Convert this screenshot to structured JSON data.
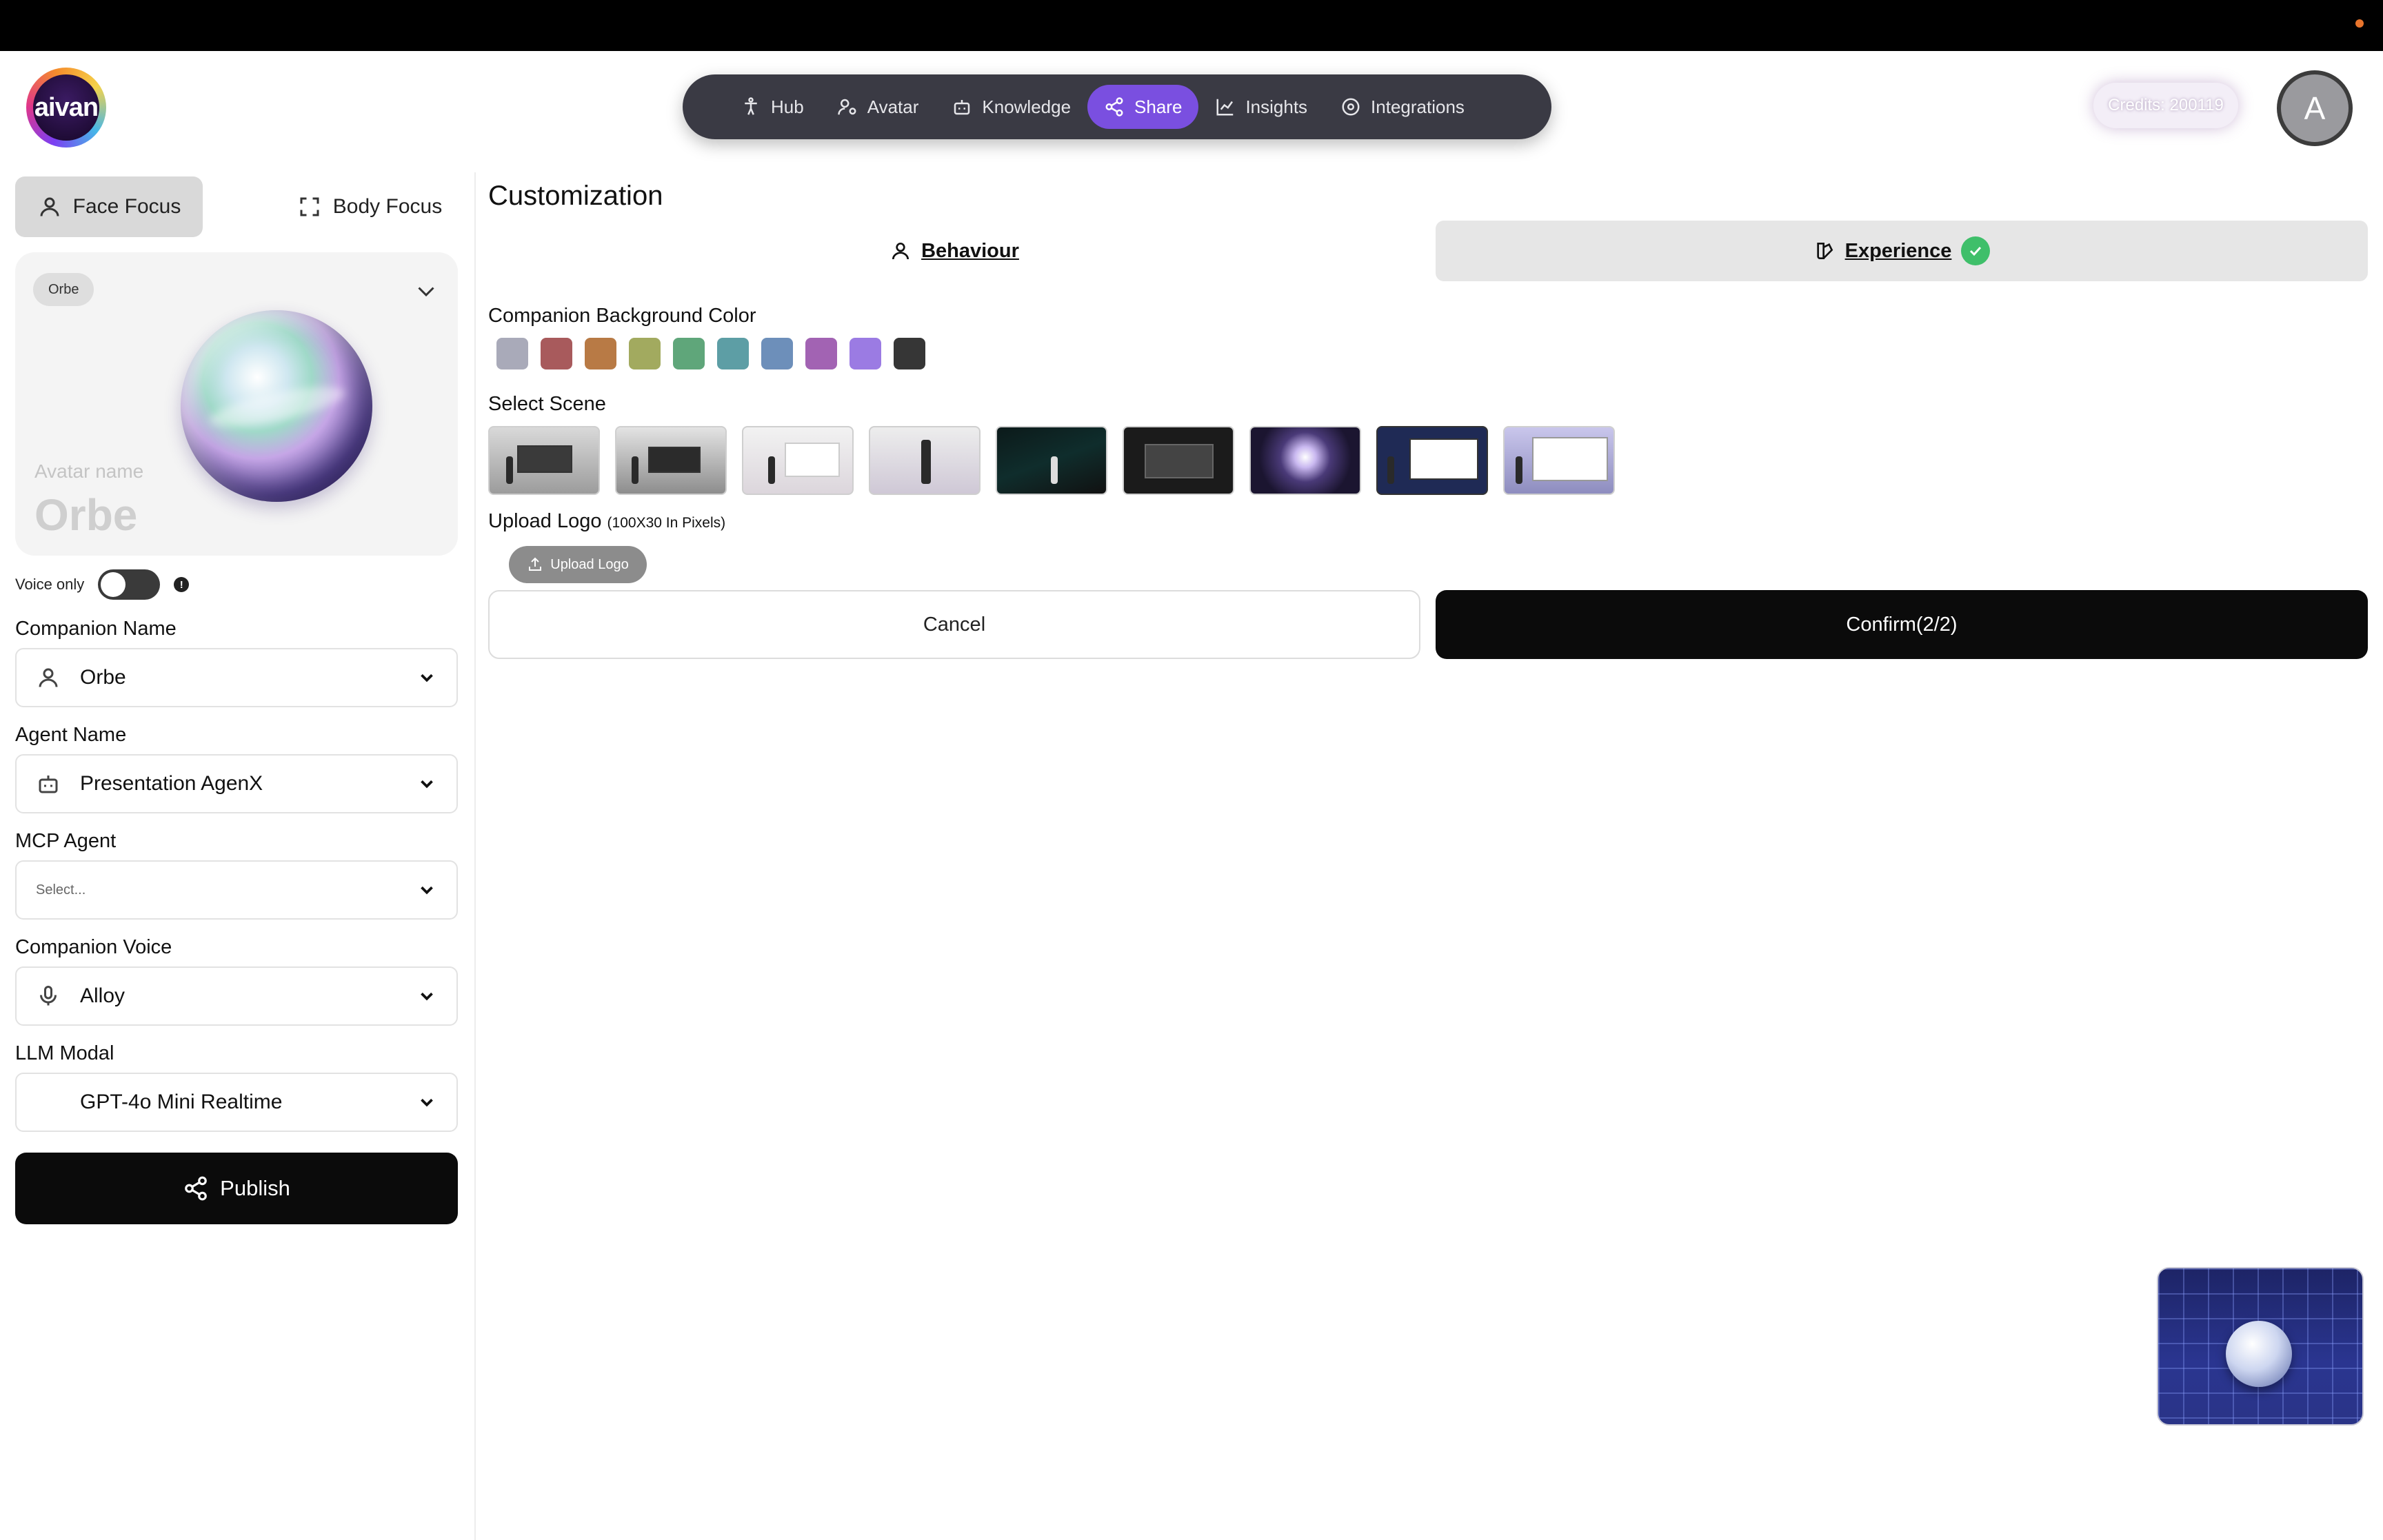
{
  "header": {
    "logo_text": "aivan",
    "nav": [
      {
        "label": "Hub",
        "icon": "accessibility-icon"
      },
      {
        "label": "Avatar",
        "icon": "user-cog-icon"
      },
      {
        "label": "Knowledge",
        "icon": "robot-icon"
      },
      {
        "label": "Share",
        "icon": "share-icon",
        "active": true
      },
      {
        "label": "Insights",
        "icon": "chart-line-icon"
      },
      {
        "label": "Integrations",
        "icon": "integrations-icon"
      }
    ],
    "credits": "Credits: 200119",
    "avatar_initial": "A"
  },
  "left": {
    "focus_tabs": {
      "face": "Face Focus",
      "body": "Body Focus"
    },
    "avatar_card": {
      "chip": "Orbe",
      "label": "Avatar name",
      "name": "Orbe"
    },
    "voice_only": "Voice only",
    "fields": {
      "companion_name": {
        "label": "Companion Name",
        "value": "Orbe"
      },
      "agent_name": {
        "label": "Agent Name",
        "value": "Presentation AgenX"
      },
      "mcp_agent": {
        "label": "MCP Agent",
        "placeholder": "Select..."
      },
      "companion_voice": {
        "label": "Companion Voice",
        "value": "Alloy"
      },
      "llm_modal": {
        "label": "LLM Modal",
        "value": "GPT-4o Mini Realtime"
      }
    },
    "publish": "Publish"
  },
  "main": {
    "title": "Customization",
    "tabs": {
      "behaviour": "Behaviour",
      "experience": "Experience"
    },
    "bg_color_label": "Companion Background Color",
    "colors": [
      "#a9aab9",
      "#a85a5c",
      "#b87a45",
      "#a2aa5f",
      "#5fa67a",
      "#5d9ea5",
      "#6d8fba",
      "#a263b3",
      "#9b7be3",
      "#363636"
    ],
    "scene_label": "Select Scene",
    "upload": {
      "label": "Upload Logo",
      "hint": "(100X30 In Pixels)",
      "button": "Upload Logo"
    },
    "cancel": "Cancel",
    "confirm": "Confirm(2/2)"
  }
}
